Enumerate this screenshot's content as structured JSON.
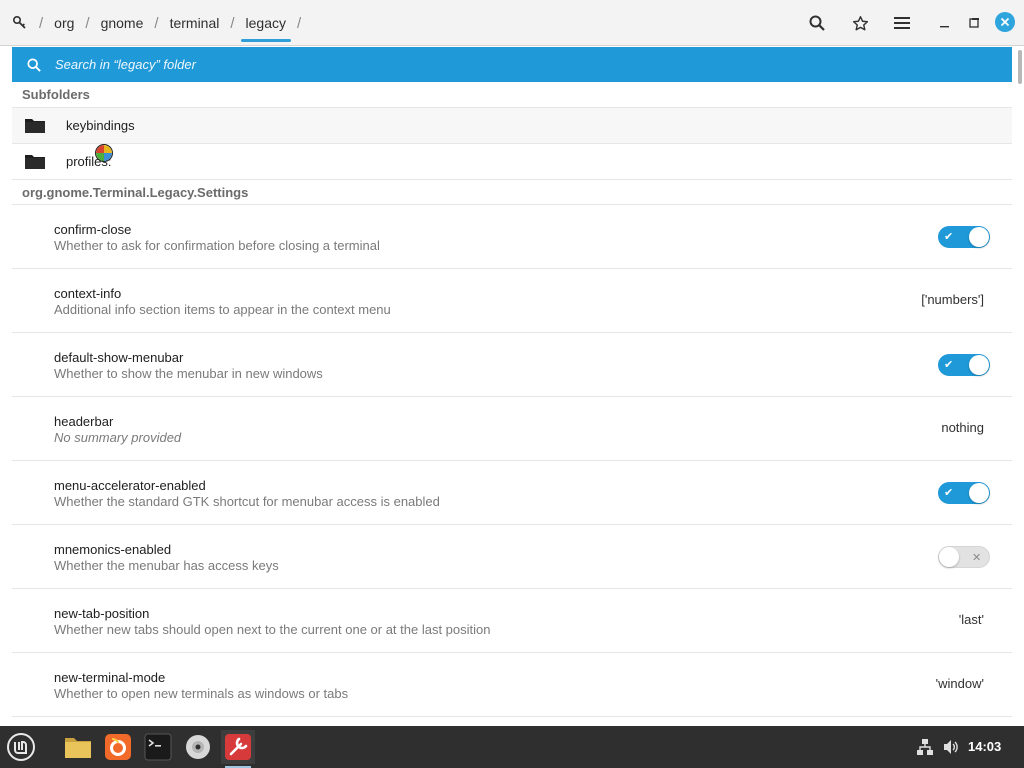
{
  "header": {
    "path": [
      "org",
      "gnome",
      "terminal",
      "legacy"
    ],
    "icons": [
      "home-key-icon",
      "search-icon",
      "star-icon",
      "menu-icon",
      "minimize-icon",
      "maximize-icon",
      "close-icon"
    ]
  },
  "search": {
    "placeholder": "Search in “legacy” folder"
  },
  "subfolders": {
    "title": "Subfolders",
    "items": [
      {
        "label": "keybindings"
      },
      {
        "label": "profiles:"
      }
    ]
  },
  "schema": {
    "title": "org.gnome.Terminal.Legacy.Settings",
    "keys": [
      {
        "name": "confirm-close",
        "summary": "Whether to ask for confirmation before closing a terminal",
        "type": "switch",
        "state": "on"
      },
      {
        "name": "context-info",
        "summary": "Additional info section items to appear in the context menu",
        "type": "value",
        "value": "['numbers']"
      },
      {
        "name": "default-show-menubar",
        "summary": "Whether to show the menubar in new windows",
        "type": "switch",
        "state": "on"
      },
      {
        "name": "headerbar",
        "summary": "No summary provided",
        "type": "value",
        "value": "nothing"
      },
      {
        "name": "menu-accelerator-enabled",
        "summary": "Whether the standard GTK shortcut for menubar access is enabled",
        "type": "switch",
        "state": "on"
      },
      {
        "name": "mnemonics-enabled",
        "summary": "Whether the menubar has access keys",
        "type": "switch",
        "state": "off"
      },
      {
        "name": "new-tab-position",
        "summary": "Whether new tabs should open next to the current one or at the last position",
        "type": "value",
        "value": "'last'"
      },
      {
        "name": "new-terminal-mode",
        "summary": "Whether to open new terminals as windows or tabs",
        "type": "value",
        "value": "'window'"
      }
    ]
  },
  "switch_marks": {
    "on": "✔",
    "off": "✕"
  },
  "taskbar": {
    "apps": [
      "mint-menu-icon",
      "files-icon",
      "firefox-icon",
      "terminal-icon",
      "disc-icon",
      "dconf-editor-icon"
    ],
    "tray": [
      "network-icon",
      "volume-icon"
    ],
    "clock": "14:03"
  },
  "colors": {
    "accent": "#1f99d8",
    "taskbar": "#2f2f2f",
    "header": "#f3f3f3"
  }
}
